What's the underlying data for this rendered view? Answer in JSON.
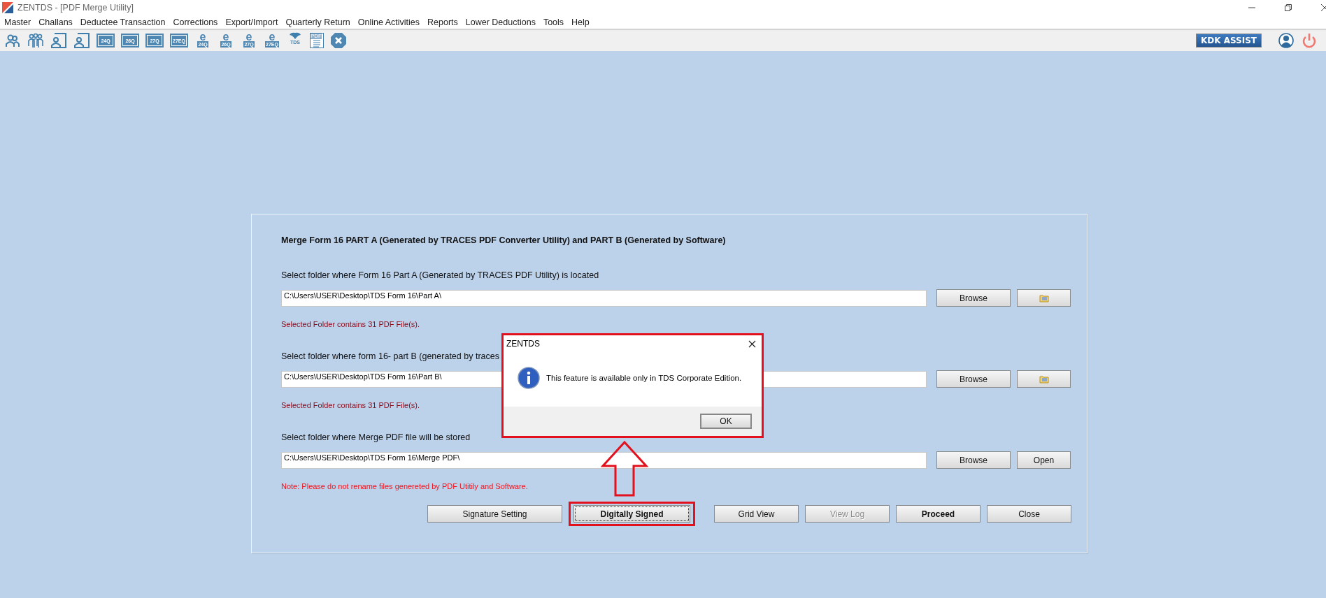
{
  "window": {
    "title": "ZENTDS - [PDF Merge Utility]"
  },
  "menu": [
    "Master",
    "Challans",
    "Deductee Transaction",
    "Corrections",
    "Export/Import",
    "Quarterly Return",
    "Online Activities",
    "Reports",
    "Lower Deductions",
    "Tools",
    "Help"
  ],
  "toolbar": [
    {
      "kind": "person"
    },
    {
      "kind": "group"
    },
    {
      "kind": "person-form"
    },
    {
      "kind": "person-form"
    },
    {
      "kind": "form",
      "label": "24Q"
    },
    {
      "kind": "form",
      "label": "26Q"
    },
    {
      "kind": "form",
      "label": "27Q"
    },
    {
      "kind": "form",
      "label": "27EQ"
    },
    {
      "kind": "e-form",
      "glyph": "e",
      "label": "24Q"
    },
    {
      "kind": "e-form",
      "glyph": "e",
      "label": "26Q"
    },
    {
      "kind": "e-form",
      "glyph": "e",
      "label": "27Q"
    },
    {
      "kind": "e-form",
      "glyph": "e",
      "label": "27EQ"
    },
    {
      "kind": "tds",
      "label": "TDS"
    },
    {
      "kind": "pdf",
      "label": "PDF"
    },
    {
      "kind": "close"
    }
  ],
  "assist_button": "KDK ASSIST",
  "panel": {
    "heading": "Merge Form 16 PART A (Generated by TRACES PDF Converter Utility) and PART B (Generated by Software)",
    "rows": [
      {
        "label": "Select folder where Form 16 Part A (Generated by TRACES PDF Utility) is located",
        "path": "C:\\Users\\USER\\Desktop\\TDS Form 16\\Part A\\",
        "buttons": [
          {
            "kind": "text",
            "label": "Browse"
          },
          {
            "kind": "folder"
          }
        ],
        "note": {
          "kind": "info",
          "text": "Selected Folder contains 31 PDF File(s)."
        }
      },
      {
        "label": "Select folder where form 16- part B (generated by traces",
        "path": "C:\\Users\\USER\\Desktop\\TDS Form 16\\Part B\\",
        "buttons": [
          {
            "kind": "text",
            "label": "Browse"
          },
          {
            "kind": "folder"
          }
        ],
        "note": {
          "kind": "info",
          "text": "Selected Folder contains 31 PDF File(s)."
        }
      },
      {
        "label": "Select folder where Merge PDF file will be stored",
        "path": "C:\\Users\\USER\\Desktop\\TDS Form 16\\Merge PDF\\",
        "buttons": [
          {
            "kind": "text",
            "label": "Browse"
          },
          {
            "kind": "text",
            "label": "Open"
          }
        ],
        "note": {
          "kind": "warning",
          "text": "Note: Please do not rename files genereted by PDF Utitily and Software."
        }
      }
    ],
    "actions": [
      {
        "label": "Signature Setting",
        "bold": false,
        "disabled": false,
        "highlighted": false
      },
      {
        "label": "Digitally Signed",
        "bold": true,
        "disabled": false,
        "highlighted": true
      },
      {
        "label": "Grid View",
        "bold": false,
        "disabled": false,
        "highlighted": false
      },
      {
        "label": "View Log",
        "bold": false,
        "disabled": true,
        "highlighted": false
      },
      {
        "label": "Proceed",
        "bold": true,
        "disabled": false,
        "highlighted": false
      },
      {
        "label": "Close",
        "bold": false,
        "disabled": false,
        "highlighted": false
      }
    ]
  },
  "dialog": {
    "title": "ZENTDS",
    "message": "This feature is available only in TDS Corporate Edition.",
    "button": "OK",
    "highlighted": true
  }
}
